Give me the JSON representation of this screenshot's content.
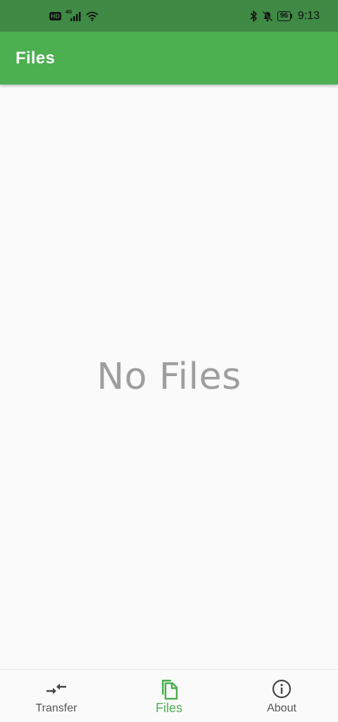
{
  "status_bar": {
    "hd_label": "HD",
    "network_type": "4G",
    "battery_level": "96",
    "time": "9:13"
  },
  "app_bar": {
    "title": "Files"
  },
  "main": {
    "empty_message": "No Files"
  },
  "bottom_nav": {
    "items": [
      {
        "label": "Transfer",
        "icon": "transfer-icon",
        "active": false
      },
      {
        "label": "Files",
        "icon": "files-icon",
        "active": true
      },
      {
        "label": "About",
        "icon": "info-icon",
        "active": false
      }
    ]
  },
  "colors": {
    "status_bar_bg": "#3f8a45",
    "app_bar_bg": "#4caf50",
    "active_accent": "#4caf50",
    "inactive_icon": "#555555",
    "empty_text": "#9e9e9e",
    "background": "#fafafa"
  }
}
